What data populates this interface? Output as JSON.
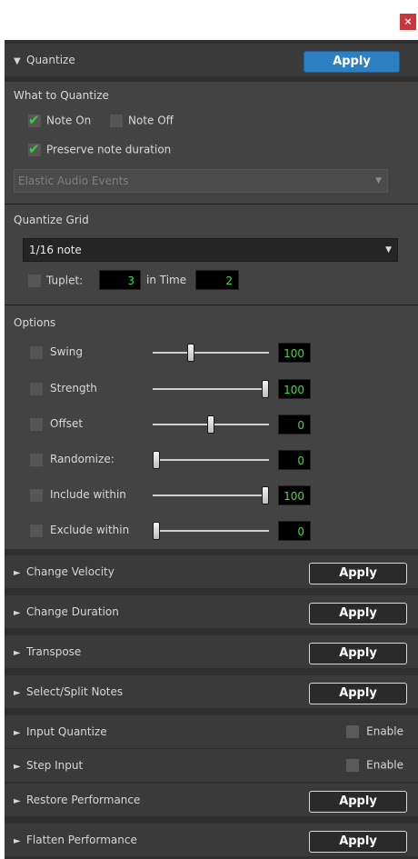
{
  "window": {
    "close_label": "×"
  },
  "quantize": {
    "title": "Quantize",
    "apply_label": "Apply",
    "what_to_quantize": {
      "title": "What to Quantize",
      "note_on": {
        "label": "Note On",
        "checked": true
      },
      "note_off": {
        "label": "Note Off",
        "checked": false
      },
      "preserve": {
        "label": "Preserve note duration",
        "checked": true
      },
      "dropdown_value": "Elastic Audio Events"
    },
    "grid": {
      "title": "Quantize Grid",
      "value": "1/16 note",
      "tuplet_label": "Tuplet:",
      "tuplet_value": "3",
      "in_time_label": "in Time",
      "in_time_value": "2"
    },
    "options": {
      "title": "Options",
      "rows": [
        {
          "label": "Swing",
          "value": "100",
          "slider_fraction": 0.32
        },
        {
          "label": "Strength",
          "value": "100",
          "slider_fraction": 1.0
        },
        {
          "label": "Offset",
          "value": "0",
          "slider_fraction": 0.5
        },
        {
          "label": "Randomize:",
          "value": "0",
          "slider_fraction": 0.0
        },
        {
          "label": "Include within",
          "value": "100",
          "slider_fraction": 1.0
        },
        {
          "label": "Exclude within",
          "value": "0",
          "slider_fraction": 0.0
        }
      ]
    }
  },
  "sections": [
    {
      "title": "Change Velocity",
      "action": "Apply"
    },
    {
      "title": "Change Duration",
      "action": "Apply"
    },
    {
      "title": "Transpose",
      "action": "Apply"
    },
    {
      "title": "Select/Split Notes",
      "action": "Apply"
    },
    {
      "title": "Input Quantize",
      "enable": "Enable"
    },
    {
      "title": "Step Input",
      "enable": "Enable"
    },
    {
      "title": "Restore Performance",
      "action": "Apply"
    },
    {
      "title": "Flatten Performance",
      "action": "Apply"
    }
  ],
  "glyphs": {
    "expanded": "▼",
    "collapsed": "►",
    "dropdown": "▼"
  },
  "colors": {
    "accent": "#2c7fc0",
    "number_text": "#3cdc3c",
    "check": "#37d23a",
    "close": "#c8383a"
  }
}
